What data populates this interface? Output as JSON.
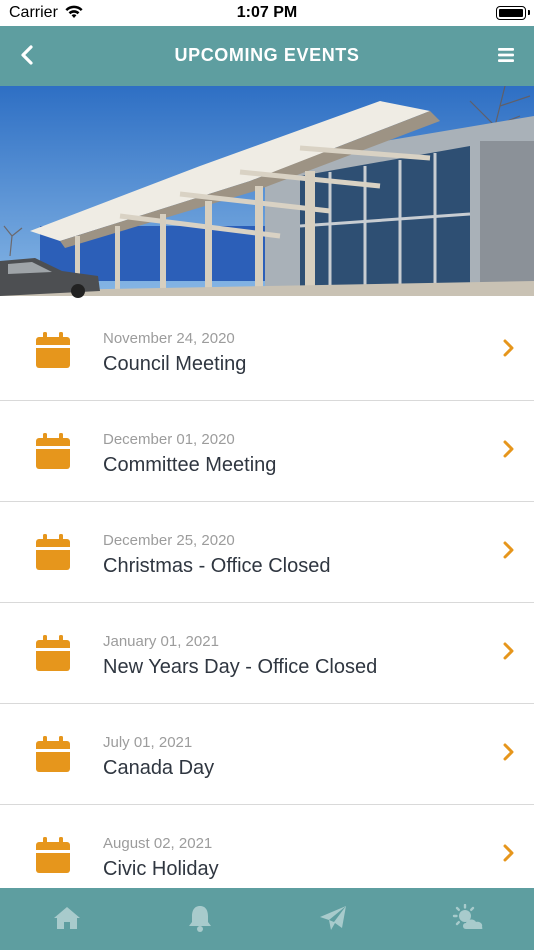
{
  "status_bar": {
    "carrier": "Carrier",
    "time": "1:07 PM"
  },
  "nav": {
    "title": "UPCOMING EVENTS",
    "back_icon": "chevron-left-icon",
    "menu_icon": "hamburger-menu-icon"
  },
  "colors": {
    "teal": "#5e9ea0",
    "accent": "#e6961c",
    "date_gray": "#9c9c9c",
    "title_dark": "#2f3640"
  },
  "events": [
    {
      "date": "November 24, 2020",
      "name": "Council Meeting"
    },
    {
      "date": "December 01, 2020",
      "name": "Committee Meeting"
    },
    {
      "date": "December 25, 2020",
      "name": "Christmas - Office Closed"
    },
    {
      "date": "January 01, 2021",
      "name": "New Years Day - Office Closed"
    },
    {
      "date": "July 01, 2021",
      "name": "Canada Day"
    },
    {
      "date": "August 02, 2021",
      "name": "Civic Holiday"
    }
  ],
  "tab_bar": {
    "icons": [
      "home-icon",
      "bell-icon",
      "paper-plane-icon",
      "weather-icon"
    ]
  }
}
